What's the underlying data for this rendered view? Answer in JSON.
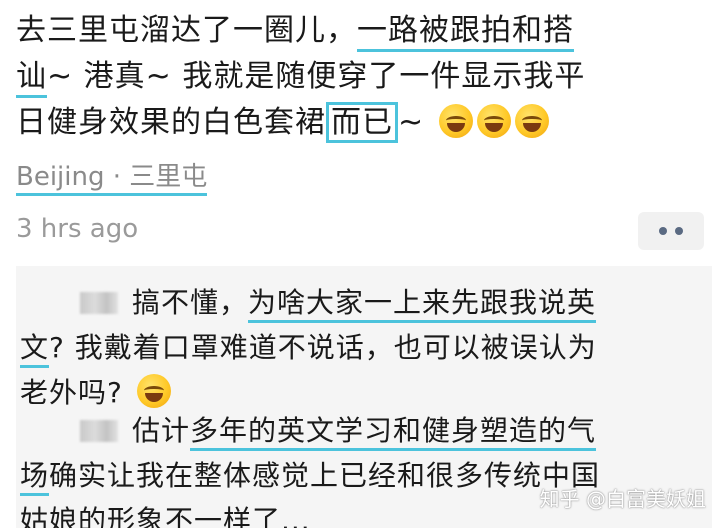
{
  "post": {
    "line1a": "去三里屯溜达了一圈儿，",
    "line1b": "一路被跟拍和搭",
    "line2a": "讪",
    "line2b": "~ 港真~ 我就是随便穿了一件显示我平",
    "line3a": "日健身效果的白色套裙",
    "line3b": "而已",
    "line3c": "~"
  },
  "location": {
    "city": "Beijing",
    "separator": " · ",
    "place": "三里屯"
  },
  "timestamp": "3 hrs ago",
  "comments": [
    {
      "line1a": "搞不懂，",
      "line1b": "为啥大家一上来先跟我说英",
      "line2a": "文",
      "line2b": "? 我戴着口罩难道不说话，也可以被误认为",
      "line3": "老外吗?"
    },
    {
      "line1a": "估计",
      "line1b": "多年的英文学习和健身塑造的气",
      "line2a": "场",
      "line2b": "确实让我在整体感觉上已经和很多传统中国",
      "line3": "姑娘的形象不一样了..."
    }
  ],
  "watermark": "知乎 @白富美妖姐",
  "colors": {
    "highlight": "#4cc3dc",
    "comment_bg": "#f5f5f5",
    "meta_text": "#9a9a9a"
  },
  "icons": {
    "emoji": "laughing-crying-emoji",
    "more": "more-dots-icon",
    "avatar": "blurred-avatar"
  }
}
